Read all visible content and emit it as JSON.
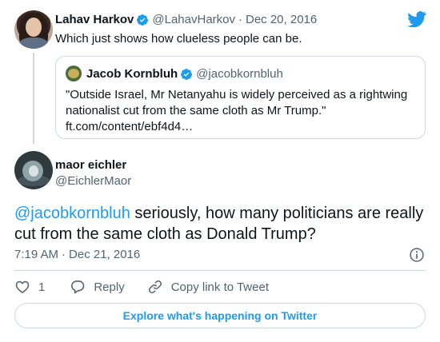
{
  "parent": {
    "name": "Lahav Harkov",
    "handle": "@LahavHarkov",
    "separator": "·",
    "date": "Dec 20, 2016",
    "text": "Which just shows how clueless people can be."
  },
  "quoted": {
    "name": "Jacob Kornbluh",
    "handle": "@jacobkornbluh",
    "text": "\"Outside Israel, Mr Netanyahu is widely perceived as a rightwing nationalist cut from the same cloth as Mr Trump.\"",
    "link": "ft.com/content/ebf4d4…"
  },
  "main": {
    "name": "maor eichler",
    "handle": "@EichlerMaor",
    "mention": "@jacobkornbluh",
    "text": " seriously, how many politicians are really cut from the same cloth as Donald Trump?",
    "time": "7:19 AM",
    "separator": "·",
    "date": "Dec 21, 2016"
  },
  "actions": {
    "like_count": "1",
    "reply_label": "Reply",
    "copy_label": "Copy link to Tweet"
  },
  "explore_label": "Explore what's happening on Twitter",
  "colors": {
    "accent": "#1d9bf0",
    "text": "#0f1419",
    "secondary": "#536471",
    "border": "#cfd9de"
  }
}
